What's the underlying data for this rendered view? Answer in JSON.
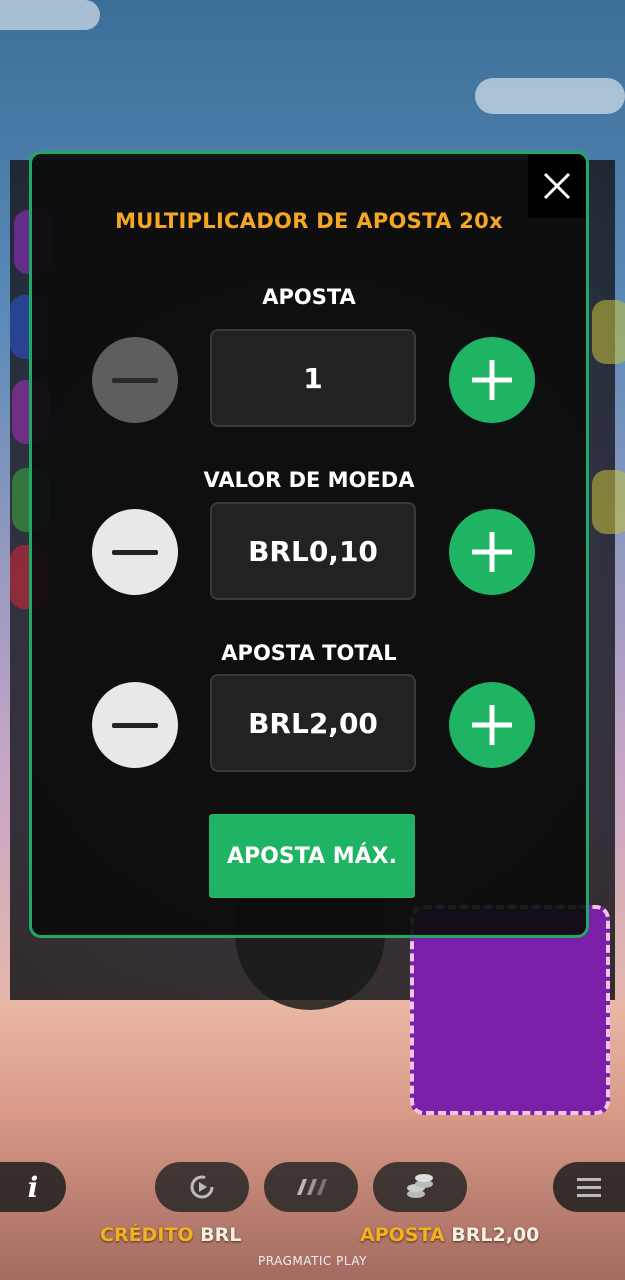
{
  "modal": {
    "title": "MULTIPLICADOR DE APOSTA 20x",
    "bet": {
      "label": "APOSTA",
      "value": "1",
      "minus_enabled": false
    },
    "coin_value": {
      "label": "VALOR DE MOEDA",
      "value": "BRL0,10"
    },
    "total_bet": {
      "label": "APOSTA TOTAL",
      "value": "BRL2,00"
    },
    "max_bet_label": "APOSTA MÁX."
  },
  "footer": {
    "credit_key": "CRÉDITO",
    "credit_value": "BRL",
    "bet_key": "APOSTA",
    "bet_value": "BRL2,00",
    "brand": "PRAGMATIC PLAY"
  },
  "icons": {
    "close": "close-icon",
    "minus": "minus-icon",
    "plus": "plus-icon",
    "info": "info-icon",
    "autoplay": "autoplay-icon",
    "turbo": "turbo-icon",
    "coins": "coins-icon",
    "menu": "menu-icon"
  },
  "colors": {
    "accent_green": "#1fb364",
    "title_orange": "#f5a623",
    "border_green": "#1fa866"
  }
}
